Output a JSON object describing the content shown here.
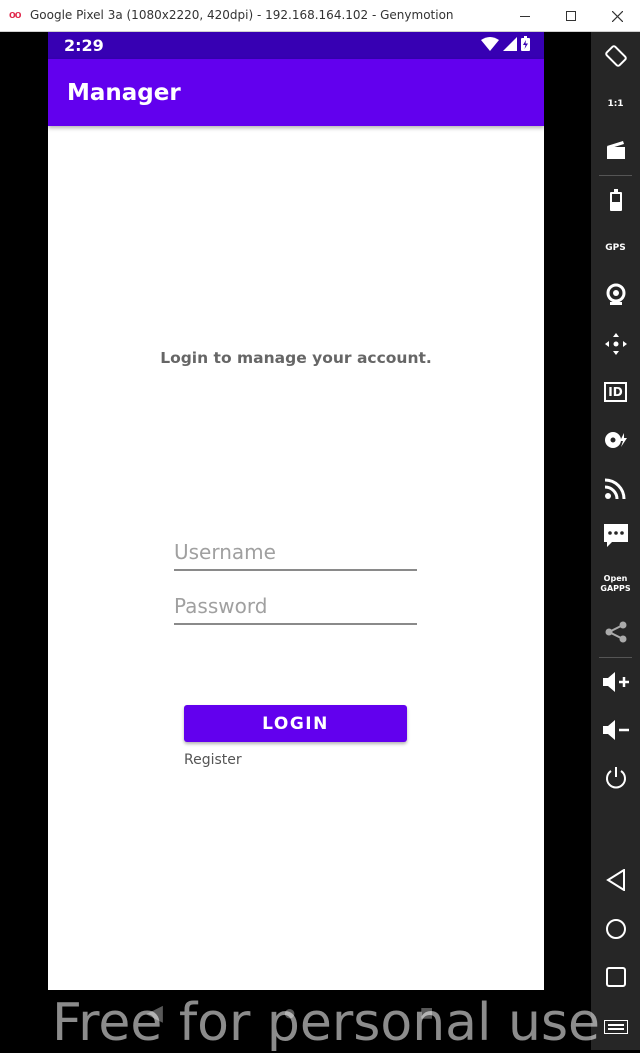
{
  "window": {
    "logo": "oo",
    "title": "Google Pixel 3a (1080x2220, 420dpi) - 192.168.164.102 - Genymotion"
  },
  "statusbar": {
    "time": "2:29"
  },
  "appbar": {
    "title": "Manager"
  },
  "login": {
    "subtitle": "Login to manage your account.",
    "username_placeholder": "Username",
    "password_placeholder": "Password",
    "login_label": "LOGIN",
    "register_label": "Register"
  },
  "sidepanel": {
    "items": [
      {
        "icon": "rotate-icon"
      },
      {
        "icon": "pixel-perfect-icon",
        "text": "1:1"
      },
      {
        "icon": "capture-icon"
      },
      {
        "icon": "battery-icon"
      },
      {
        "icon": "gps-icon",
        "text": "GPS"
      },
      {
        "icon": "camera-icon"
      },
      {
        "icon": "move-icon"
      },
      {
        "icon": "identifiers-icon",
        "text": "ID"
      },
      {
        "icon": "disk-io-icon"
      },
      {
        "icon": "network-icon"
      },
      {
        "icon": "sms-icon"
      },
      {
        "icon": "open-gapps-icon",
        "text": "Open GAPPS"
      },
      {
        "icon": "share-icon"
      },
      {
        "icon": "volume-up-icon"
      },
      {
        "icon": "volume-down-icon"
      },
      {
        "icon": "power-icon"
      },
      {
        "icon": "back-icon"
      },
      {
        "icon": "home-icon"
      },
      {
        "icon": "recents-icon"
      },
      {
        "icon": "menu-icon"
      }
    ]
  },
  "watermark": "Free for personal use",
  "colors": {
    "statusbar": "#3700b3",
    "primary": "#6200ee",
    "sidepanel": "#262626"
  }
}
